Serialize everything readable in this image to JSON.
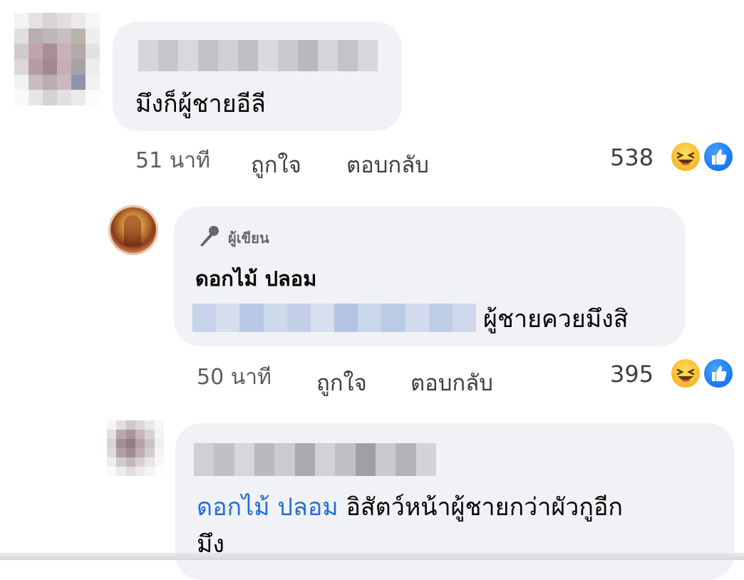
{
  "comments": [
    {
      "text": "มึงก็ผู้ชายอีลี",
      "time": "51 นาที",
      "like_label": "ถูกใจ",
      "reply_label": "ตอบกลับ",
      "reaction_count": "538",
      "reactions": [
        "haha-icon",
        "like-icon"
      ]
    },
    {
      "author_badge": "ผู้เขียน",
      "author_badge_icon": "microphone-icon",
      "author": "ดอกไม้ ปลอม",
      "text": "ผู้ชายควยมึงสิ",
      "time": "50 นาที",
      "like_label": "ถูกใจ",
      "reply_label": "ตอบกลับ",
      "reaction_count": "395",
      "reactions": [
        "haha-icon",
        "like-icon"
      ]
    },
    {
      "mention": "ดอกไม้ ปลอม",
      "text_line1": "อิสัตว์หน้าผู้ชายกว่าผัวกูอีก",
      "text_line2": "มึง"
    }
  ],
  "colors": {
    "bubble": "#f0f2f5",
    "mention": "#216fdb",
    "like_reaction": "#1877f2",
    "haha_reaction": "#f7b928"
  }
}
